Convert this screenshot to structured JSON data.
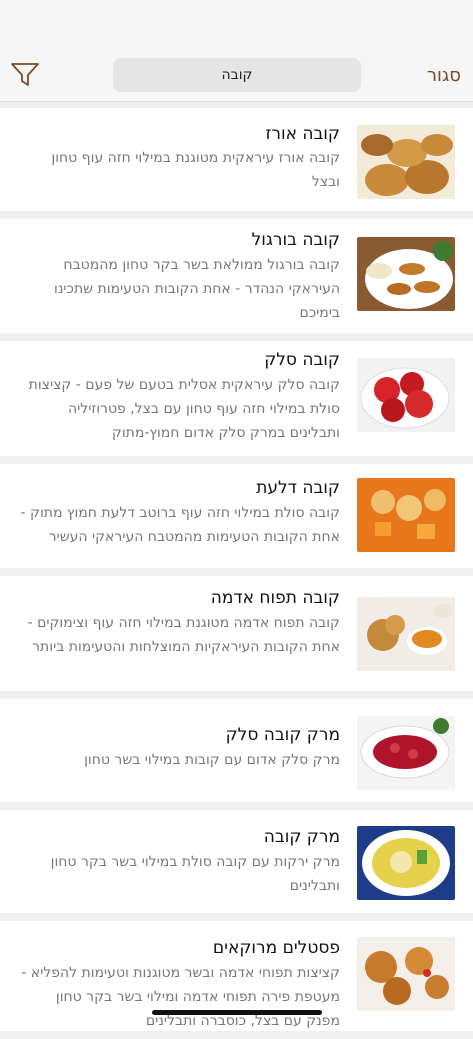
{
  "header": {
    "close_label": "סגור",
    "search_value": "קובה",
    "filter_icon": "filter-icon"
  },
  "recipes": [
    {
      "title": "קובה אורז",
      "description": "קובה אורז עיראקית מטוגנת במילוי חזה עוף טחון ובצל",
      "image": "fried-kubbeh-photo"
    },
    {
      "title": "קובה בורגול",
      "description": "קובה בורגול ממולאת בשר בקר טחון מהמטבח העיראקי הנהדר - אחת הקובות הטעימות שתכינו בימיכם",
      "image": "bulgur-kubbeh-photo"
    },
    {
      "title": "קובה סלק",
      "description": "קובה סלק עיראקית אסלית בטעם של פעם - קציצות סולת במילוי חזה עוף טחון עם בצל, פטרוזיליה ותבלינים במרק סלק אדום חמוץ-מתוק",
      "image": "beet-kubbeh-photo"
    },
    {
      "title": "קובה דלעת",
      "description": "קובה סולת במילוי חזה עוף ברוטב דלעת חמוץ מתוק - אחת הקובות הטעימות מהמטבח העיראקי העשיר",
      "image": "pumpkin-kubbeh-photo"
    },
    {
      "title": "קובה תפוח אדמה",
      "description": "קובה תפוח אדמה מטוגנת במילוי חזה עוף וצימוקים - אחת הקובות העיראקיות המוצלחות והטעימות ביותר",
      "image": "potato-kubbeh-photo"
    },
    {
      "title": "מרק קובה סלק",
      "description": "מרק סלק אדום עם קובות במילוי בשר טחון",
      "image": "beet-soup-photo"
    },
    {
      "title": "מרק קובה",
      "description": "מרק ירקות עם קובה סולת במילוי בשר בקר טחון ותבלינים",
      "image": "kubbeh-soup-photo"
    },
    {
      "title": "פסטלים מרוקאים",
      "description": "קציצות תפוחי אדמה ובשר מטוגנות וטעימות להפליא - מעטפת פירה תפוחי אדמה ומילוי בשר בקר טחון מפנק עם בצל, כוסברה ותבלינים",
      "image": "moroccan-pastels-photo"
    }
  ]
}
